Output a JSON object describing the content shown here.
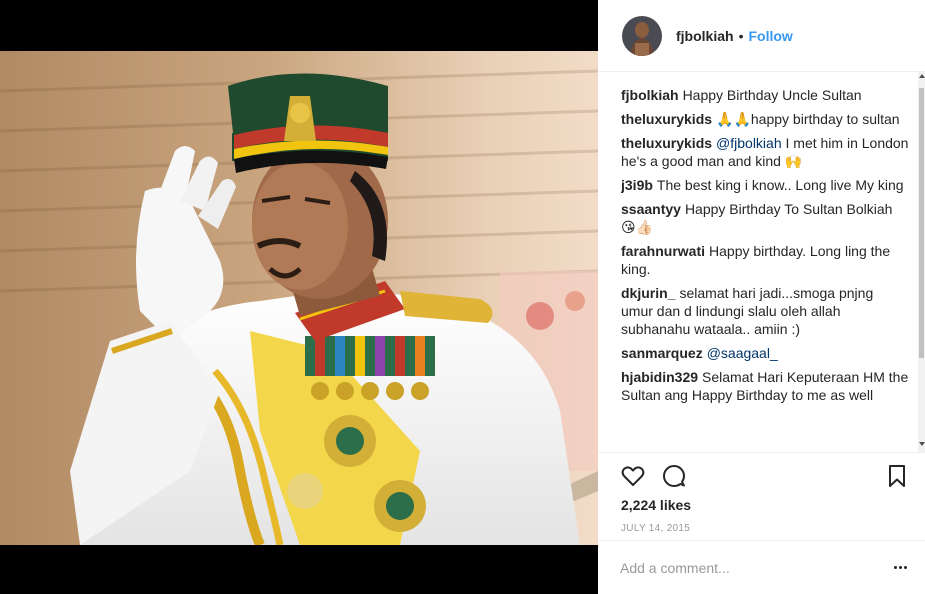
{
  "post": {
    "username": "fjbolkiah",
    "dot": "•",
    "follow_label": "Follow",
    "likes": "2,224 likes",
    "date": "JULY 14, 2015",
    "comment_placeholder": "Add a comment..."
  },
  "icons": {
    "like": "heart-icon",
    "comment": "comment-bubble-icon",
    "save": "bookmark-icon",
    "more": "more-options-icon"
  },
  "colors": {
    "link": "#3897f0",
    "mention": "#003569",
    "meta": "#999999"
  },
  "comments": [
    {
      "user": "fjbolkiah",
      "text": "Happy Birthday Uncle Sultan"
    },
    {
      "user": "theluxurykids",
      "text": "🙏🙏happy birthday to sultan"
    },
    {
      "user": "theluxurykids",
      "mention": "@fjbolkiah",
      "text": " I met him in London he's a good man and kind 🙌"
    },
    {
      "user": "j3i9b",
      "text": "The best king i know.. Long live My king"
    },
    {
      "user": "ssaantyy",
      "text": "Happy Birthday To Sultan Bolkiah 😘👍🏻"
    },
    {
      "user": "farahnurwati",
      "text": "Happy birthday. Long ling the king."
    },
    {
      "user": "dkjurin_",
      "text": "selamat hari jadi...smoga pnjng umur dan d lindungi slalu oleh allah subhanahu wataala.. amiin :)"
    },
    {
      "user": "sanmarquez",
      "mention": "@saagaal_",
      "text": ""
    },
    {
      "user": "hjabidin329",
      "text": "Selamat Hari Keputeraan HM the Sultan ang Happy Birthday to me as well"
    }
  ]
}
